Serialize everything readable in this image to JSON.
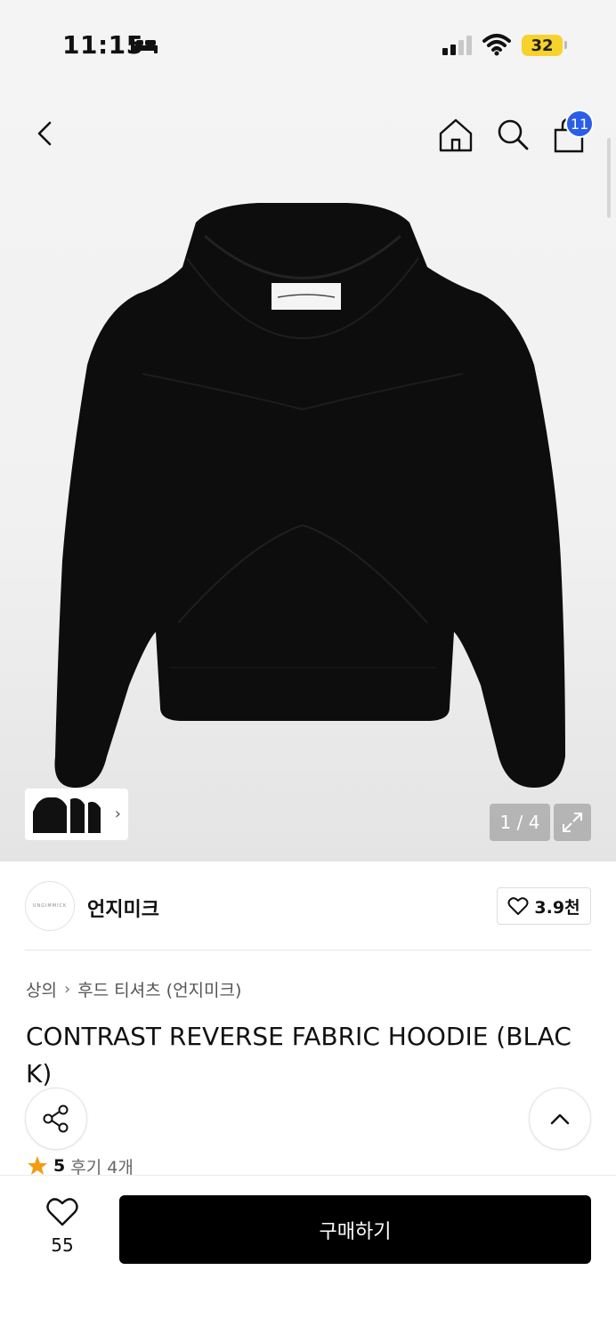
{
  "status_bar": {
    "time": "11:15",
    "battery": "32"
  },
  "nav": {
    "cart_count": "11"
  },
  "gallery": {
    "pager": "1 / 4"
  },
  "brand": {
    "name": "언지미크",
    "logo_text": "UNGIMMICK",
    "likes": "3.9천"
  },
  "breadcrumb": {
    "category": "상의",
    "subcategory": "후드 티셔츠 (언지미크)"
  },
  "product": {
    "title": "CONTRAST REVERSE FABRIC HOODIE (BLACK)"
  },
  "rating": {
    "score": "5",
    "reviews": "후기 4개"
  },
  "bottom_bar": {
    "wish_count": "55",
    "buy_label": "구매하기"
  },
  "colors": {
    "cart_badge": "#2a5ee8",
    "battery": "#f7d22c",
    "star": "#f39c12"
  }
}
